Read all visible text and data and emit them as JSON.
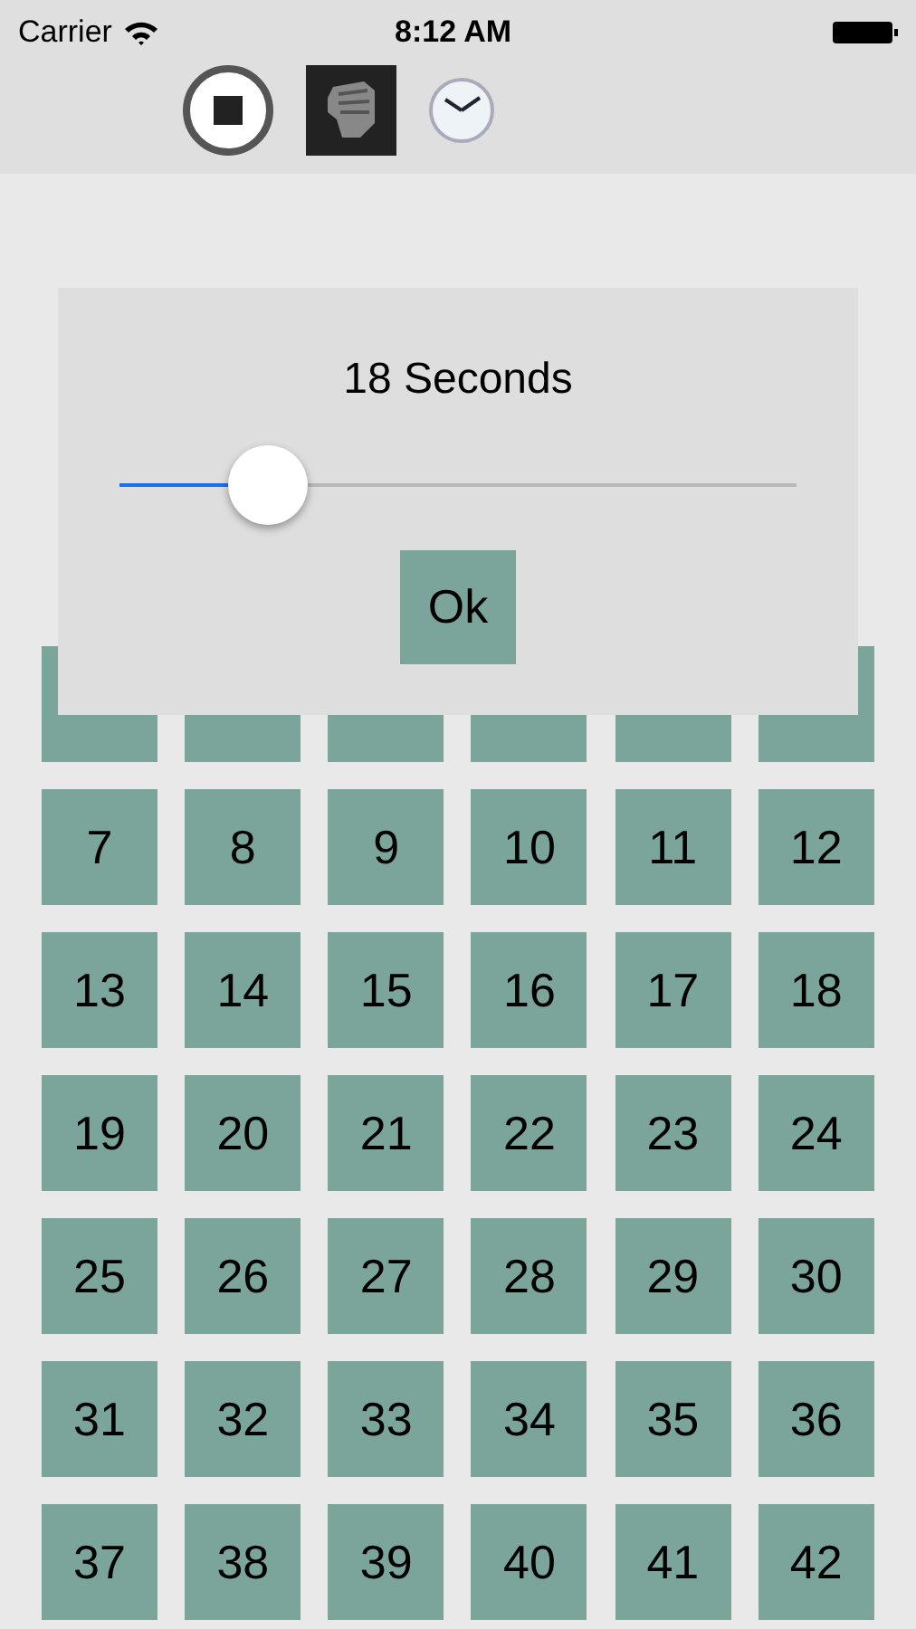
{
  "status_bar": {
    "carrier": "Carrier",
    "time": "8:12 AM"
  },
  "dialog": {
    "title": "18 Seconds",
    "slider": {
      "level": 0.22
    },
    "button": "Ok"
  },
  "tiles": [
    {
      "kind": "covered"
    },
    {
      "kind": "covered"
    },
    {
      "kind": "covered"
    },
    {
      "kind": "covered"
    },
    {
      "kind": "covered"
    },
    {
      "kind": "covered"
    },
    {
      "kind": "number",
      "label": "7"
    },
    {
      "kind": "number",
      "label": "8"
    },
    {
      "kind": "number",
      "label": "9"
    },
    {
      "kind": "number",
      "label": "10"
    },
    {
      "kind": "number",
      "label": "11"
    },
    {
      "kind": "number",
      "label": "12"
    },
    {
      "kind": "number",
      "label": "13"
    },
    {
      "kind": "number",
      "label": "14"
    },
    {
      "kind": "number",
      "label": "15"
    },
    {
      "kind": "number",
      "label": "16"
    },
    {
      "kind": "number",
      "label": "17"
    },
    {
      "kind": "number",
      "label": "18"
    },
    {
      "kind": "number",
      "label": "19"
    },
    {
      "kind": "number",
      "label": "20"
    },
    {
      "kind": "number",
      "label": "21"
    },
    {
      "kind": "number",
      "label": "22"
    },
    {
      "kind": "number",
      "label": "23"
    },
    {
      "kind": "number",
      "label": "24"
    },
    {
      "kind": "number",
      "label": "25"
    },
    {
      "kind": "number",
      "label": "26"
    },
    {
      "kind": "number",
      "label": "27"
    },
    {
      "kind": "number",
      "label": "28"
    },
    {
      "kind": "number",
      "label": "29"
    },
    {
      "kind": "number",
      "label": "30"
    },
    {
      "kind": "number",
      "label": "31"
    },
    {
      "kind": "number",
      "label": "32"
    },
    {
      "kind": "number",
      "label": "33"
    },
    {
      "kind": "number",
      "label": "34"
    },
    {
      "kind": "number",
      "label": "35"
    },
    {
      "kind": "number",
      "label": "36"
    },
    {
      "kind": "number",
      "label": "37"
    },
    {
      "kind": "number",
      "label": "38"
    },
    {
      "kind": "number",
      "label": "39"
    },
    {
      "kind": "number",
      "label": "40"
    },
    {
      "kind": "number",
      "label": "41"
    },
    {
      "kind": "number",
      "label": "42"
    }
  ]
}
